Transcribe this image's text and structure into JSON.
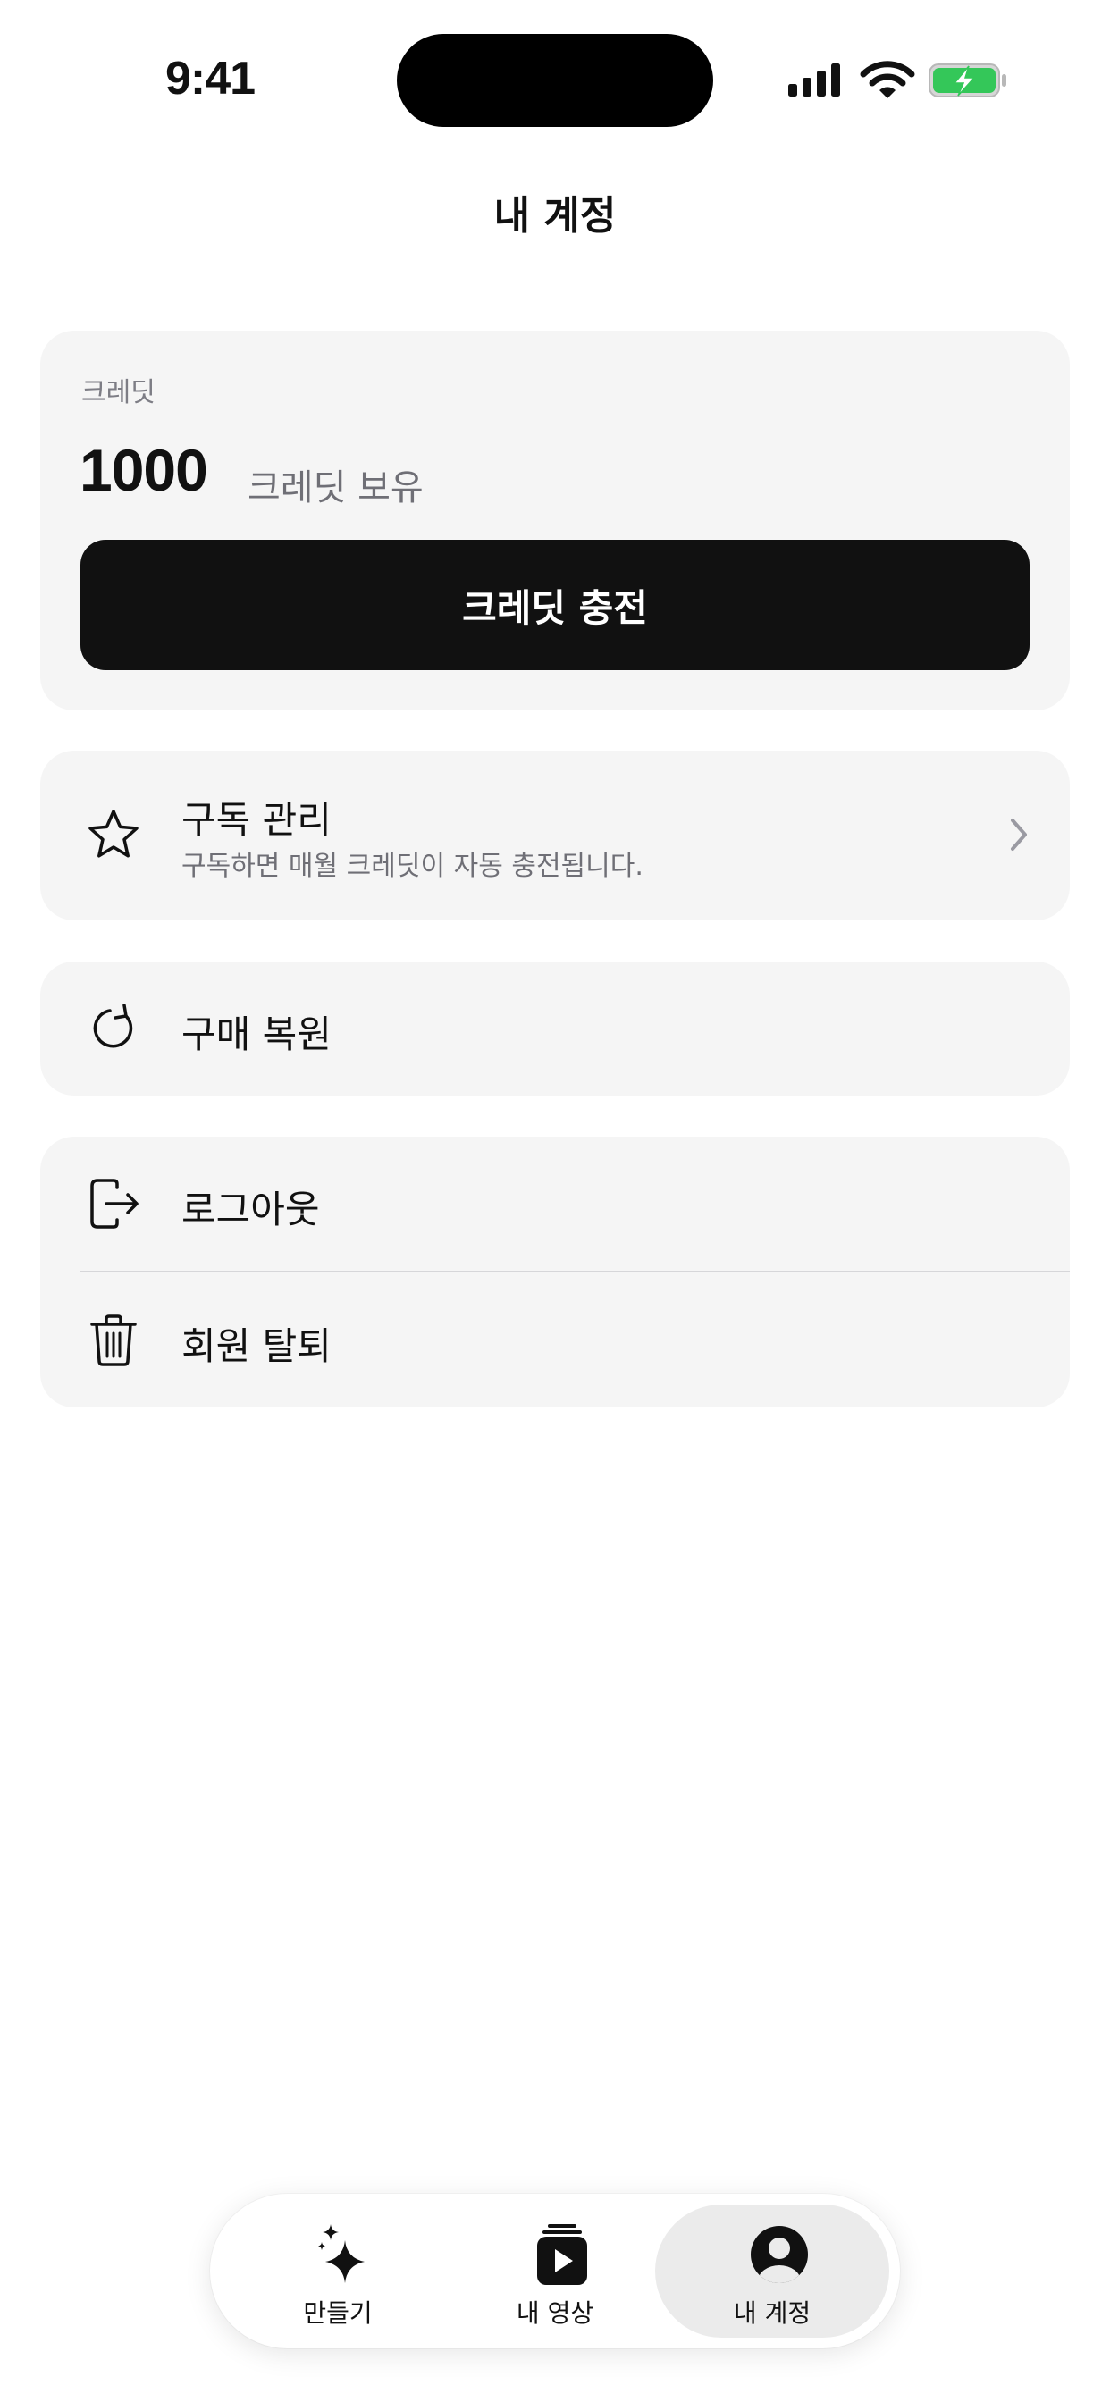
{
  "status_bar": {
    "time": "9:41",
    "icons": [
      "cellular-signal-icon",
      "wifi-icon",
      "battery-charging-icon"
    ],
    "battery_color": "#34c759"
  },
  "header": {
    "title": "내 계정"
  },
  "credit_card": {
    "label": "크레딧",
    "amount": "1000",
    "amount_suffix": "크레딧 보유",
    "charge_button": "크레딧 충전"
  },
  "subscription": {
    "icon": "star-icon",
    "title": "구독 관리",
    "description": "구독하면 매월 크레딧이 자동 충전됩니다."
  },
  "restore": {
    "icon": "refresh-icon",
    "label": "구매 복원"
  },
  "account_actions": {
    "logout": {
      "icon": "logout-icon",
      "label": "로그아웃"
    },
    "withdraw": {
      "icon": "trash-icon",
      "label": "회원 탈퇴"
    }
  },
  "tab_bar": {
    "tabs": [
      {
        "icon": "sparkles-icon",
        "label": "만들기",
        "active": false
      },
      {
        "icon": "video-stack-icon",
        "label": "내 영상",
        "active": false
      },
      {
        "icon": "user-avatar-icon",
        "label": "내 계정",
        "active": true
      }
    ]
  },
  "colors": {
    "background": "#ffffff",
    "card": "#f5f5f5",
    "primary_button": "#111111",
    "secondary_text": "#6f6f76"
  }
}
